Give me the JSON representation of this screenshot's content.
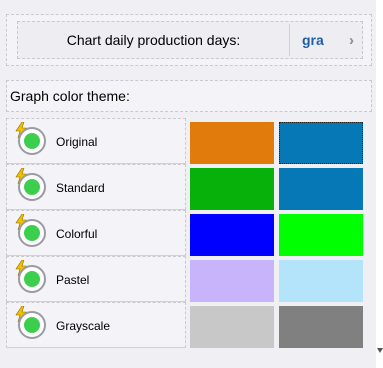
{
  "production": {
    "label": "Chart daily production days:",
    "value": "gra",
    "chevron": "›"
  },
  "theme_header": "Graph color theme:",
  "themes": [
    {
      "name": "Original",
      "icon": "lightning-icon",
      "selected_indicator": "radio-green",
      "color_a": "#e07b0c",
      "color_b": "#0678b6"
    },
    {
      "name": "Standard",
      "icon": "lightning-icon",
      "selected_indicator": "radio-green",
      "color_a": "#07b10a",
      "color_b": "#0678b6"
    },
    {
      "name": "Colorful",
      "icon": "lightning-icon",
      "selected_indicator": "radio-green",
      "color_a": "#0000ff",
      "color_b": "#00ff00"
    },
    {
      "name": "Pastel",
      "icon": "lightning-icon",
      "selected_indicator": "radio-green",
      "color_a": "#c8b4fa",
      "color_b": "#b4e4fa"
    },
    {
      "name": "Grayscale",
      "icon": "lightning-icon",
      "selected_indicator": "radio-green",
      "color_a": "#c8c8c8",
      "color_b": "#808080"
    }
  ]
}
